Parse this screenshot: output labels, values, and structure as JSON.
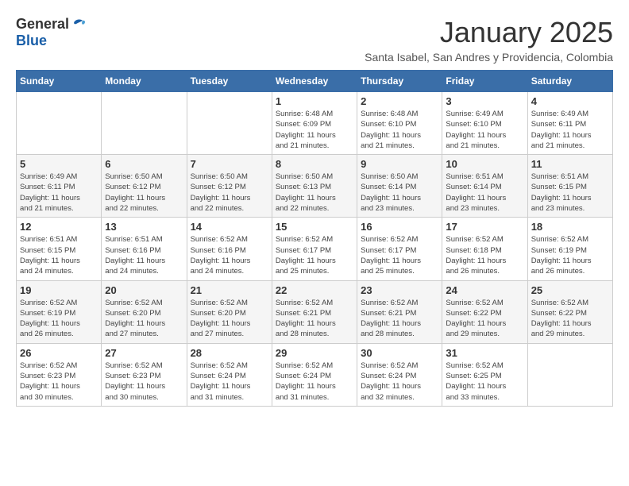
{
  "logo": {
    "general": "General",
    "blue": "Blue"
  },
  "title": "January 2025",
  "subtitle": "Santa Isabel, San Andres y Providencia, Colombia",
  "headers": [
    "Sunday",
    "Monday",
    "Tuesday",
    "Wednesday",
    "Thursday",
    "Friday",
    "Saturday"
  ],
  "weeks": [
    [
      {
        "day": "",
        "info": ""
      },
      {
        "day": "",
        "info": ""
      },
      {
        "day": "",
        "info": ""
      },
      {
        "day": "1",
        "info": "Sunrise: 6:48 AM\nSunset: 6:09 PM\nDaylight: 11 hours\nand 21 minutes."
      },
      {
        "day": "2",
        "info": "Sunrise: 6:48 AM\nSunset: 6:10 PM\nDaylight: 11 hours\nand 21 minutes."
      },
      {
        "day": "3",
        "info": "Sunrise: 6:49 AM\nSunset: 6:10 PM\nDaylight: 11 hours\nand 21 minutes."
      },
      {
        "day": "4",
        "info": "Sunrise: 6:49 AM\nSunset: 6:11 PM\nDaylight: 11 hours\nand 21 minutes."
      }
    ],
    [
      {
        "day": "5",
        "info": "Sunrise: 6:49 AM\nSunset: 6:11 PM\nDaylight: 11 hours\nand 21 minutes."
      },
      {
        "day": "6",
        "info": "Sunrise: 6:50 AM\nSunset: 6:12 PM\nDaylight: 11 hours\nand 22 minutes."
      },
      {
        "day": "7",
        "info": "Sunrise: 6:50 AM\nSunset: 6:12 PM\nDaylight: 11 hours\nand 22 minutes."
      },
      {
        "day": "8",
        "info": "Sunrise: 6:50 AM\nSunset: 6:13 PM\nDaylight: 11 hours\nand 22 minutes."
      },
      {
        "day": "9",
        "info": "Sunrise: 6:50 AM\nSunset: 6:14 PM\nDaylight: 11 hours\nand 23 minutes."
      },
      {
        "day": "10",
        "info": "Sunrise: 6:51 AM\nSunset: 6:14 PM\nDaylight: 11 hours\nand 23 minutes."
      },
      {
        "day": "11",
        "info": "Sunrise: 6:51 AM\nSunset: 6:15 PM\nDaylight: 11 hours\nand 23 minutes."
      }
    ],
    [
      {
        "day": "12",
        "info": "Sunrise: 6:51 AM\nSunset: 6:15 PM\nDaylight: 11 hours\nand 24 minutes."
      },
      {
        "day": "13",
        "info": "Sunrise: 6:51 AM\nSunset: 6:16 PM\nDaylight: 11 hours\nand 24 minutes."
      },
      {
        "day": "14",
        "info": "Sunrise: 6:52 AM\nSunset: 6:16 PM\nDaylight: 11 hours\nand 24 minutes."
      },
      {
        "day": "15",
        "info": "Sunrise: 6:52 AM\nSunset: 6:17 PM\nDaylight: 11 hours\nand 25 minutes."
      },
      {
        "day": "16",
        "info": "Sunrise: 6:52 AM\nSunset: 6:17 PM\nDaylight: 11 hours\nand 25 minutes."
      },
      {
        "day": "17",
        "info": "Sunrise: 6:52 AM\nSunset: 6:18 PM\nDaylight: 11 hours\nand 26 minutes."
      },
      {
        "day": "18",
        "info": "Sunrise: 6:52 AM\nSunset: 6:19 PM\nDaylight: 11 hours\nand 26 minutes."
      }
    ],
    [
      {
        "day": "19",
        "info": "Sunrise: 6:52 AM\nSunset: 6:19 PM\nDaylight: 11 hours\nand 26 minutes."
      },
      {
        "day": "20",
        "info": "Sunrise: 6:52 AM\nSunset: 6:20 PM\nDaylight: 11 hours\nand 27 minutes."
      },
      {
        "day": "21",
        "info": "Sunrise: 6:52 AM\nSunset: 6:20 PM\nDaylight: 11 hours\nand 27 minutes."
      },
      {
        "day": "22",
        "info": "Sunrise: 6:52 AM\nSunset: 6:21 PM\nDaylight: 11 hours\nand 28 minutes."
      },
      {
        "day": "23",
        "info": "Sunrise: 6:52 AM\nSunset: 6:21 PM\nDaylight: 11 hours\nand 28 minutes."
      },
      {
        "day": "24",
        "info": "Sunrise: 6:52 AM\nSunset: 6:22 PM\nDaylight: 11 hours\nand 29 minutes."
      },
      {
        "day": "25",
        "info": "Sunrise: 6:52 AM\nSunset: 6:22 PM\nDaylight: 11 hours\nand 29 minutes."
      }
    ],
    [
      {
        "day": "26",
        "info": "Sunrise: 6:52 AM\nSunset: 6:23 PM\nDaylight: 11 hours\nand 30 minutes."
      },
      {
        "day": "27",
        "info": "Sunrise: 6:52 AM\nSunset: 6:23 PM\nDaylight: 11 hours\nand 30 minutes."
      },
      {
        "day": "28",
        "info": "Sunrise: 6:52 AM\nSunset: 6:24 PM\nDaylight: 11 hours\nand 31 minutes."
      },
      {
        "day": "29",
        "info": "Sunrise: 6:52 AM\nSunset: 6:24 PM\nDaylight: 11 hours\nand 31 minutes."
      },
      {
        "day": "30",
        "info": "Sunrise: 6:52 AM\nSunset: 6:24 PM\nDaylight: 11 hours\nand 32 minutes."
      },
      {
        "day": "31",
        "info": "Sunrise: 6:52 AM\nSunset: 6:25 PM\nDaylight: 11 hours\nand 33 minutes."
      },
      {
        "day": "",
        "info": ""
      }
    ]
  ]
}
